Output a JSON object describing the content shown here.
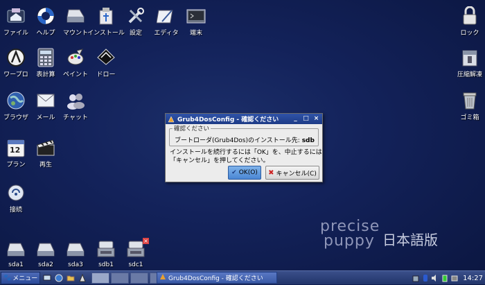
{
  "desktop": {
    "left_icons": [
      {
        "label": "ファイル"
      },
      {
        "label": "ヘルプ"
      },
      {
        "label": "マウント"
      },
      {
        "label": "インストール"
      },
      {
        "label": "設定"
      },
      {
        "label": "エディタ"
      },
      {
        "label": "端末"
      },
      {
        "label": "ワープロ"
      },
      {
        "label": "表計算"
      },
      {
        "label": "ペイント"
      },
      {
        "label": "ドロー"
      },
      {
        "label": "ブラウザ"
      },
      {
        "label": "メール"
      },
      {
        "label": "チャット"
      },
      {
        "label": "プラン"
      },
      {
        "label": "再生"
      },
      {
        "label": "接続"
      }
    ],
    "right_icons": [
      {
        "label": "ロック"
      },
      {
        "label": "圧縮解凍"
      },
      {
        "label": "ゴミ箱"
      }
    ],
    "drives": [
      {
        "label": "sda1"
      },
      {
        "label": "sda2"
      },
      {
        "label": "sda3"
      },
      {
        "label": "sdb1"
      },
      {
        "label": "sdc1"
      }
    ],
    "calendar_day": "12"
  },
  "dialog": {
    "title": "Grub4DosConfig - 確認ください",
    "frame_legend": "確認ください",
    "frame_text": "ブートローダ(Grub4Dos)のインストール先: ",
    "frame_target": "sdb",
    "message_line1": "インストールを続行するには「OK」を、中止するには",
    "message_line2": "「キャンセル」を押してください。",
    "ok_label": "OK(O)",
    "cancel_label": "キャンセル(C)",
    "minimize": "_",
    "maximize": "□",
    "close": "×"
  },
  "watermark": {
    "line1": "precise",
    "line2": "puppy",
    "edition": "日本語版"
  },
  "taskbar": {
    "menu_label": "メニュー",
    "task_title": "Grub4DosConfig - 確認ください",
    "clock": "14:27"
  }
}
